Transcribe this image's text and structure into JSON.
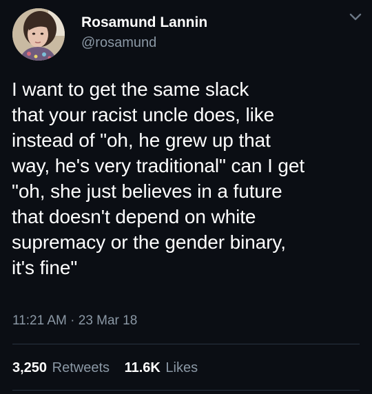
{
  "author": {
    "display_name": "Rosamund Lannin",
    "handle": "@rosamund",
    "avatar_icon": "profile-photo"
  },
  "menu_icon": "chevron-down-icon",
  "tweet": {
    "lines": [
      "I want to get the same slack",
      "that your racist uncle does, like",
      "instead of \"oh, he grew up that",
      "way, he's very traditional\" can I get",
      "\"oh, she just believes in a future",
      "that doesn't depend on white",
      "supremacy or the gender binary,",
      "it's fine\""
    ],
    "timestamp": "11:21 AM · 23 Mar 18"
  },
  "stats": {
    "retweets_count": "3,250",
    "retweets_label": "Retweets",
    "likes_count": "11.6K",
    "likes_label": "Likes"
  },
  "colors": {
    "background": "#0b0e14",
    "text_primary": "#ffffff",
    "text_secondary": "#8b98a5",
    "divider": "#283341"
  }
}
